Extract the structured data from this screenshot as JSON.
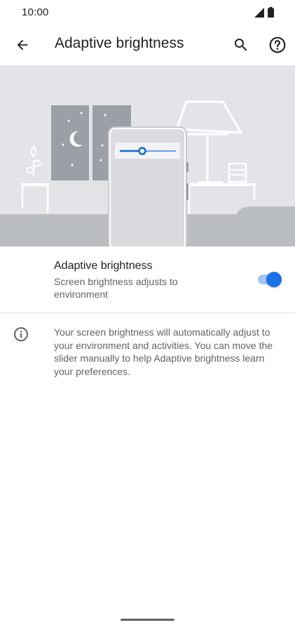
{
  "status_bar": {
    "time": "10:00"
  },
  "app_bar": {
    "title": "Adaptive brightness",
    "back_icon": "arrow-back-icon",
    "search_icon": "search-icon",
    "help_icon": "help-icon"
  },
  "preference": {
    "title": "Adaptive brightness",
    "summary": "Screen brightness adjusts to environment",
    "enabled": true
  },
  "info": {
    "icon": "info-icon",
    "text": "Your screen brightness will automatically adjust to your environment and activities. You can move the slider manually to help Adaptive brightness learn your preferences."
  },
  "colors": {
    "accent": "#1a73e8",
    "illustration_bg": "#e3e4e8"
  }
}
